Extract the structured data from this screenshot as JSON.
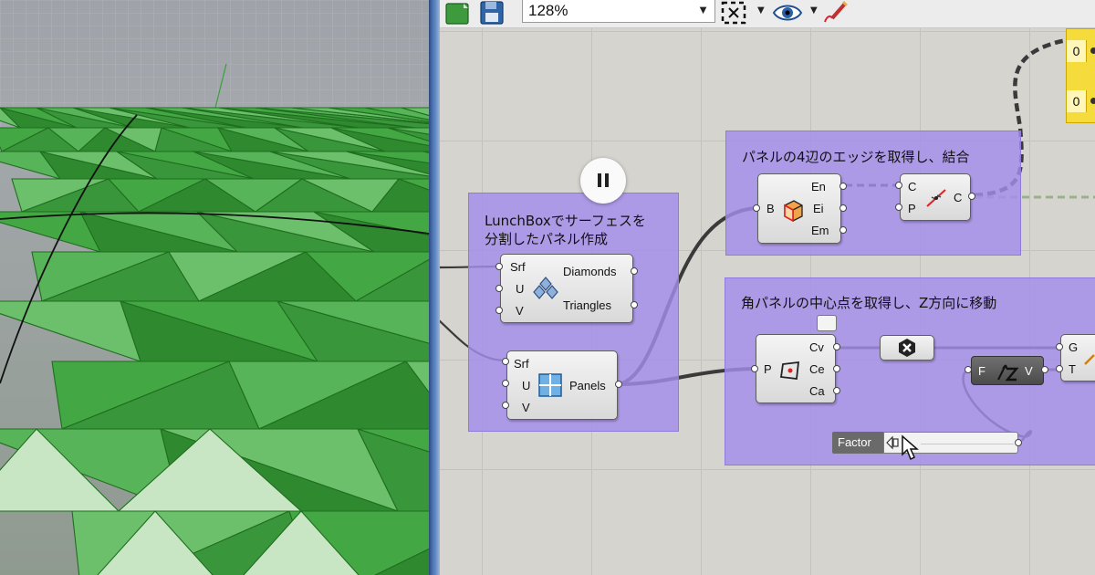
{
  "toolbar": {
    "zoom_value": "128%",
    "icons": [
      "open-file-icon",
      "save-icon",
      "zoom-extents-icon",
      "preview-eye-icon",
      "sketch-pen-icon"
    ]
  },
  "groups": [
    {
      "title_line1": "LunchBoxでサーフェスを",
      "title_line2": "分割したパネル作成"
    },
    {
      "title": "パネルの4辺のエッジを取得し、結合"
    },
    {
      "title": "角パネルの中心点を取得し、Z方向に移動"
    }
  ],
  "components": {
    "diamonds": {
      "inputs": [
        "Srf",
        "U",
        "V"
      ],
      "outputs": [
        "Diamonds",
        "Triangles"
      ],
      "icon": "diamond-panels-icon"
    },
    "panels": {
      "inputs": [
        "Srf",
        "U",
        "V"
      ],
      "outputs": [
        "Panels"
      ],
      "icon": "quad-panels-icon"
    },
    "brep_edges": {
      "inputs": [
        "B"
      ],
      "outputs": [
        "En",
        "Ei",
        "Em"
      ],
      "icon": "box-edges-icon"
    },
    "join_curves": {
      "inputs": [
        "C",
        "P"
      ],
      "outputs": [
        "C"
      ],
      "icon": "join-curves-icon"
    },
    "area": {
      "inputs": [
        "P"
      ],
      "outputs": [
        "Cv",
        "Ce",
        "Ca"
      ],
      "icon": "area-centroid-icon"
    },
    "cull": {
      "icon": "cull-x-icon"
    },
    "unit_z": {
      "inputs": [
        "F"
      ],
      "outputs": [
        "V"
      ],
      "icon": "unit-z-icon"
    },
    "move": {
      "inputs": [
        "G",
        "T"
      ]
    }
  },
  "slider": {
    "label": "Factor"
  },
  "panel_values": [
    "0",
    "0"
  ],
  "colors": {
    "group_fill": "#a48eeb",
    "canvas": "#d6d4cf",
    "surface_green": "#3f9e3f",
    "panel_yellow": "#f5dc3c"
  }
}
